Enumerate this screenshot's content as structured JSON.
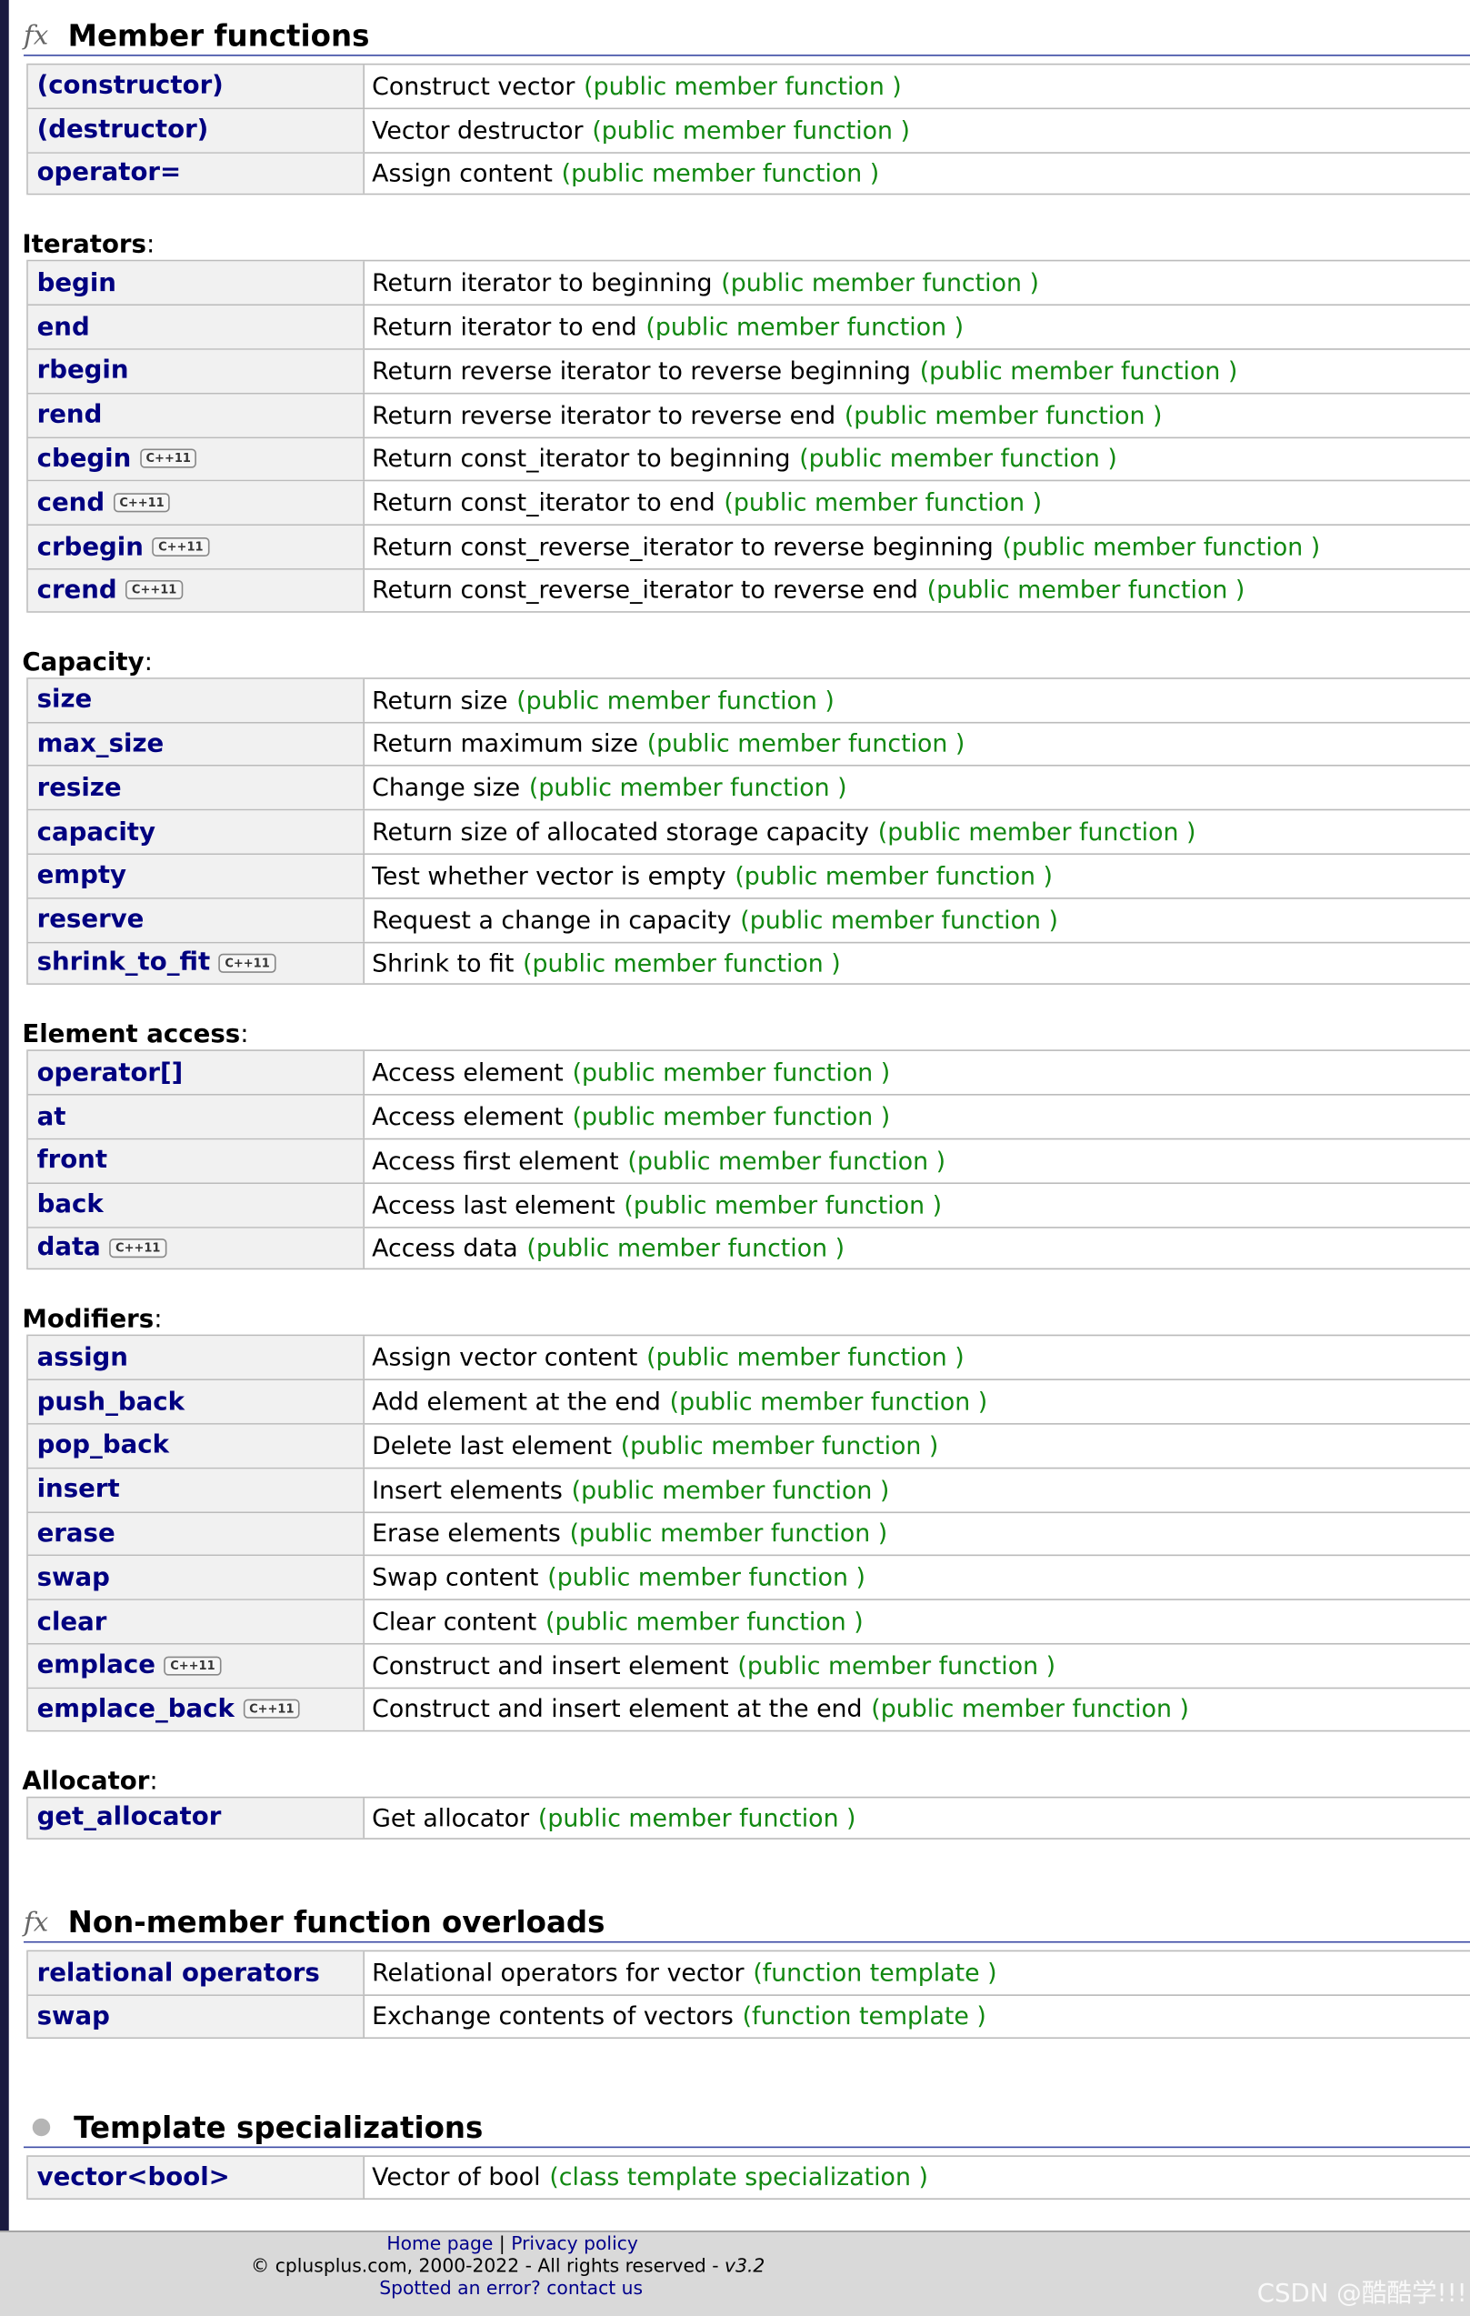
{
  "cpp11_badge": "C++11",
  "sections": [
    {
      "title": "Member functions",
      "icon": "fx-icon",
      "icon_glyph": "fx",
      "groups": [
        {
          "label": "",
          "rows": [
            {
              "name": "(constructor)",
              "cpp11": false,
              "desc": "Construct vector",
              "kind": "(public member function )"
            },
            {
              "name": "(destructor)",
              "cpp11": false,
              "desc": "Vector destructor",
              "kind": "(public member function )"
            },
            {
              "name": "operator=",
              "cpp11": false,
              "desc": "Assign content",
              "kind": "(public member function )"
            }
          ]
        },
        {
          "label": "Iterators",
          "rows": [
            {
              "name": "begin",
              "cpp11": false,
              "desc": "Return iterator to beginning",
              "kind": "(public member function )"
            },
            {
              "name": "end",
              "cpp11": false,
              "desc": "Return iterator to end",
              "kind": "(public member function )"
            },
            {
              "name": "rbegin",
              "cpp11": false,
              "desc": "Return reverse iterator to reverse beginning",
              "kind": "(public member function )"
            },
            {
              "name": "rend",
              "cpp11": false,
              "desc": "Return reverse iterator to reverse end",
              "kind": "(public member function )"
            },
            {
              "name": "cbegin",
              "cpp11": true,
              "desc": "Return const_iterator to beginning",
              "kind": "(public member function )"
            },
            {
              "name": "cend",
              "cpp11": true,
              "desc": "Return const_iterator to end",
              "kind": "(public member function )"
            },
            {
              "name": "crbegin",
              "cpp11": true,
              "desc": "Return const_reverse_iterator to reverse beginning",
              "kind": "(public member function )"
            },
            {
              "name": "crend",
              "cpp11": true,
              "desc": "Return const_reverse_iterator to reverse end",
              "kind": "(public member function )"
            }
          ]
        },
        {
          "label": "Capacity",
          "rows": [
            {
              "name": "size",
              "cpp11": false,
              "desc": "Return size",
              "kind": "(public member function )"
            },
            {
              "name": "max_size",
              "cpp11": false,
              "desc": "Return maximum size",
              "kind": "(public member function )"
            },
            {
              "name": "resize",
              "cpp11": false,
              "desc": "Change size",
              "kind": "(public member function )"
            },
            {
              "name": "capacity",
              "cpp11": false,
              "desc": "Return size of allocated storage capacity",
              "kind": "(public member function )"
            },
            {
              "name": "empty",
              "cpp11": false,
              "desc": "Test whether vector is empty",
              "kind": "(public member function )"
            },
            {
              "name": "reserve",
              "cpp11": false,
              "desc": "Request a change in capacity",
              "kind": "(public member function )"
            },
            {
              "name": "shrink_to_fit",
              "cpp11": true,
              "desc": "Shrink to fit",
              "kind": "(public member function )"
            }
          ]
        },
        {
          "label": "Element access",
          "rows": [
            {
              "name": "operator[]",
              "cpp11": false,
              "desc": "Access element",
              "kind": "(public member function )"
            },
            {
              "name": "at",
              "cpp11": false,
              "desc": "Access element",
              "kind": "(public member function )"
            },
            {
              "name": "front",
              "cpp11": false,
              "desc": "Access first element",
              "kind": "(public member function )"
            },
            {
              "name": "back",
              "cpp11": false,
              "desc": "Access last element",
              "kind": "(public member function )"
            },
            {
              "name": "data",
              "cpp11": true,
              "desc": "Access data",
              "kind": "(public member function )"
            }
          ]
        },
        {
          "label": "Modifiers",
          "rows": [
            {
              "name": "assign",
              "cpp11": false,
              "desc": "Assign vector content",
              "kind": "(public member function )"
            },
            {
              "name": "push_back",
              "cpp11": false,
              "desc": "Add element at the end",
              "kind": "(public member function )"
            },
            {
              "name": "pop_back",
              "cpp11": false,
              "desc": "Delete last element",
              "kind": "(public member function )"
            },
            {
              "name": "insert",
              "cpp11": false,
              "desc": "Insert elements",
              "kind": "(public member function )"
            },
            {
              "name": "erase",
              "cpp11": false,
              "desc": "Erase elements",
              "kind": "(public member function )"
            },
            {
              "name": "swap",
              "cpp11": false,
              "desc": "Swap content",
              "kind": "(public member function )"
            },
            {
              "name": "clear",
              "cpp11": false,
              "desc": "Clear content",
              "kind": "(public member function )"
            },
            {
              "name": "emplace",
              "cpp11": true,
              "desc": "Construct and insert element",
              "kind": "(public member function )"
            },
            {
              "name": "emplace_back",
              "cpp11": true,
              "desc": "Construct and insert element at the end",
              "kind": "(public member function )"
            }
          ]
        },
        {
          "label": "Allocator",
          "rows": [
            {
              "name": "get_allocator",
              "cpp11": false,
              "desc": "Get allocator",
              "kind": "(public member function )"
            }
          ]
        }
      ]
    },
    {
      "title": "Non-member function overloads",
      "icon": "fx-icon",
      "icon_glyph": "fx",
      "groups": [
        {
          "label": "",
          "rows": [
            {
              "name": "relational operators",
              "cpp11": false,
              "desc": "Relational operators for vector",
              "kind": "(function template )"
            },
            {
              "name": "swap",
              "cpp11": false,
              "desc": "Exchange contents of vectors",
              "kind": "(function template )"
            }
          ]
        }
      ]
    },
    {
      "title": "Template specializations",
      "icon": "bullet-icon",
      "icon_glyph": "",
      "groups": [
        {
          "label": "",
          "rows": [
            {
              "name": "vector<bool>",
              "cpp11": false,
              "desc": "Vector of bool",
              "kind": "(class template specialization )"
            }
          ]
        }
      ]
    }
  ],
  "footer": {
    "home_link": "Home page",
    "separator": "|",
    "privacy_link": "Privacy policy",
    "copyright": "© cplusplus.com, 2000-2022 - All rights reserved - ",
    "version": "v3.2",
    "error_link": "Spotted an error? contact us"
  },
  "watermark": "CSDN @酷酷学!!!"
}
